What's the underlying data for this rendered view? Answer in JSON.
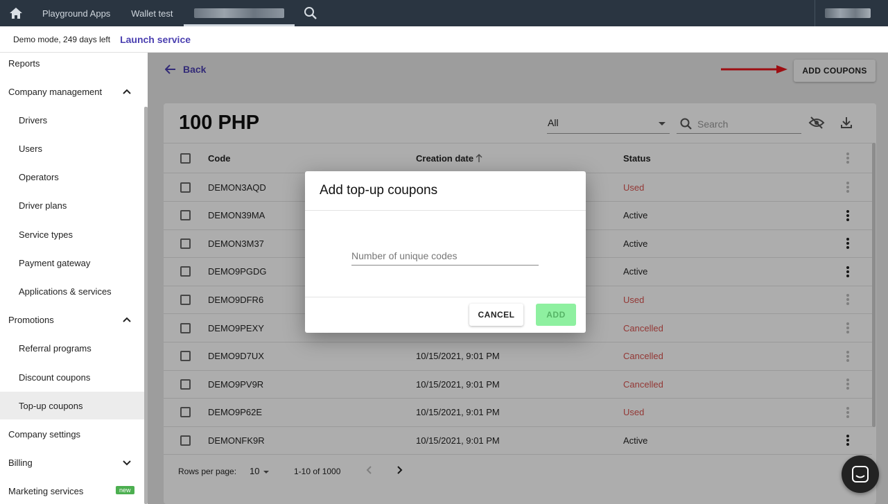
{
  "topbar": {
    "tabs": [
      {
        "label": "Playground Apps"
      },
      {
        "label": "Wallet test"
      }
    ]
  },
  "demobar": {
    "demo_text": "Demo mode, 249 days left",
    "launch_label": "Launch service"
  },
  "sidebar": {
    "items": [
      {
        "label": "Reports"
      },
      {
        "label": "Company management"
      },
      {
        "label": "Drivers"
      },
      {
        "label": "Users"
      },
      {
        "label": "Operators"
      },
      {
        "label": "Driver plans"
      },
      {
        "label": "Service types"
      },
      {
        "label": "Payment gateway"
      },
      {
        "label": "Applications & services"
      },
      {
        "label": "Promotions"
      },
      {
        "label": "Referral programs"
      },
      {
        "label": "Discount coupons"
      },
      {
        "label": "Top-up coupons"
      },
      {
        "label": "Company settings"
      },
      {
        "label": "Billing"
      },
      {
        "label": "Marketing services",
        "badge": "new"
      }
    ]
  },
  "header": {
    "back_label": "Back",
    "add_coupons_label": "ADD COUPONS"
  },
  "card": {
    "title": "100 PHP",
    "filter_value": "All",
    "search_placeholder": "Search"
  },
  "table": {
    "columns": [
      "Code",
      "Creation date",
      "Status"
    ],
    "rows": [
      {
        "code": "DEMON3AQD",
        "date": "",
        "status": "Used"
      },
      {
        "code": "DEMON39MA",
        "date": "",
        "status": "Active"
      },
      {
        "code": "DEMON3M37",
        "date": "",
        "status": "Active"
      },
      {
        "code": "DEMO9PGDG",
        "date": "",
        "status": "Active"
      },
      {
        "code": "DEMO9DFR6",
        "date": "",
        "status": "Used"
      },
      {
        "code": "DEMO9PEXY",
        "date": "",
        "status": "Cancelled"
      },
      {
        "code": "DEMO9D7UX",
        "date": "10/15/2021, 9:01 PM",
        "status": "Cancelled"
      },
      {
        "code": "DEMO9PV9R",
        "date": "10/15/2021, 9:01 PM",
        "status": "Cancelled"
      },
      {
        "code": "DEMO9P62E",
        "date": "10/15/2021, 9:01 PM",
        "status": "Used"
      },
      {
        "code": "DEMONFK9R",
        "date": "10/15/2021, 9:01 PM",
        "status": "Active"
      }
    ]
  },
  "pagination": {
    "rows_per_page_label": "Rows per page:",
    "rows_per_page": "10",
    "range": "1-10 of 1000"
  },
  "dialog": {
    "title": "Add top-up coupons",
    "field_placeholder": "Number of unique codes",
    "cancel_label": "CANCEL",
    "add_label": "ADD"
  },
  "colors": {
    "topbar": "#2a3541",
    "accent": "#4a3fb0",
    "status_red": "#d9534f",
    "add_button": "#8ef0a0"
  }
}
